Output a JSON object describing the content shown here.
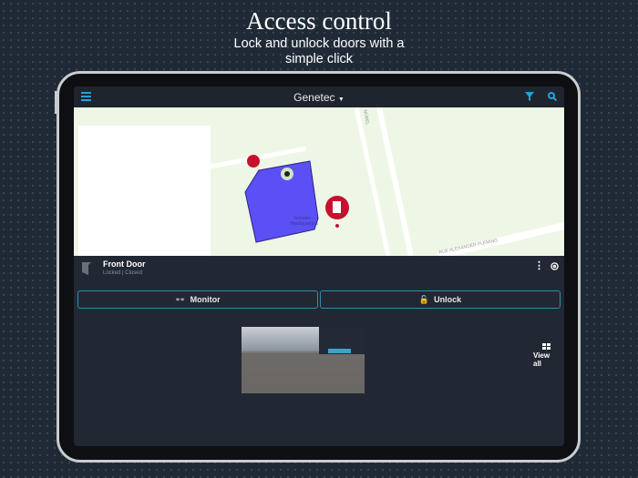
{
  "promo": {
    "title": "Access control",
    "subtitle": "Lock and unlock doors with a simple click"
  },
  "header": {
    "title": "Genetec"
  },
  "map": {
    "building_label": "Genetec - Headquarters",
    "street_label": "RUE ALEXANDER-FLEMING",
    "street_label2": "NOBEL"
  },
  "door": {
    "name": "Front Door",
    "status_lock": "Locked",
    "status_open": "Closed"
  },
  "actions": {
    "monitor": "Monitor",
    "unlock": "Unlock"
  },
  "camera": {
    "view_all": "View all"
  },
  "colors": {
    "accent": "#2d8bb5",
    "polygon": "#5b50f5",
    "pin": "#c8102e"
  }
}
